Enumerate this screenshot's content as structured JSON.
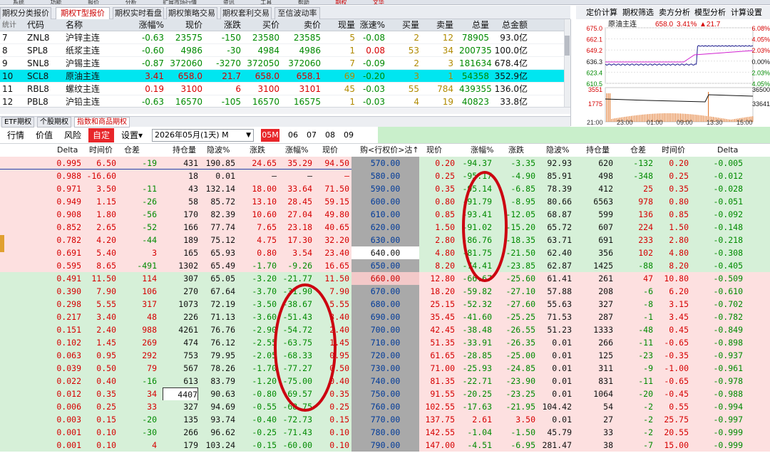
{
  "menubar": {
    "items": [
      "系统",
      "功能",
      "报价",
      "分析",
      "扩展市场行情",
      "资讯",
      "工具",
      "帮助",
      "期权",
      "文华"
    ]
  },
  "tabs": [
    "期权分类报价",
    "期权T型报价",
    "期权实时看盘",
    "期权策略交易",
    "期权套利交易",
    "至信波动率"
  ],
  "right_menu": [
    "定价计算",
    "期权筛选",
    "卖方分析",
    "模型分析",
    "计算设置"
  ],
  "futures": {
    "headers": [
      "统计",
      "代码",
      "名称",
      "涨幅%",
      "现价",
      "涨跌",
      "买价",
      "卖价",
      "现量",
      "涨速%",
      "买量",
      "卖量",
      "总量",
      "总金额"
    ],
    "rows": [
      [
        "7",
        "ZNL8",
        "沪锌主连",
        "-0.63",
        "23575",
        "-150",
        "23580",
        "23585",
        "5",
        "-0.08",
        "2",
        "12",
        "78905",
        "93.0亿"
      ],
      [
        "8",
        "SPL8",
        "纸浆主连",
        "-0.60",
        "4986",
        "-30",
        "4984",
        "4986",
        "1",
        "0.08",
        "53",
        "34",
        "200735",
        "100.0亿"
      ],
      [
        "9",
        "SNL8",
        "沪锡主连",
        "-0.87",
        "372060",
        "-3270",
        "372050",
        "372060",
        "7",
        "-0.09",
        "2",
        "3",
        "181634",
        "678.4亿"
      ],
      [
        "10",
        "SCL8",
        "原油主连",
        "3.41",
        "658.0",
        "21.7",
        "658.0",
        "658.1",
        "69",
        "-0.20",
        "3",
        "1",
        "54358",
        "352.9亿"
      ],
      [
        "11",
        "RBL8",
        "螺纹主连",
        "0.19",
        "3100",
        "6",
        "3100",
        "3101",
        "45",
        "-0.03",
        "55",
        "784",
        "439355",
        "136.0亿"
      ],
      [
        "12",
        "PBL8",
        "沪铅主连",
        "-0.63",
        "16570",
        "-105",
        "16570",
        "16575",
        "1",
        "-0.03",
        "4",
        "19",
        "40823",
        "33.8亿"
      ]
    ]
  },
  "mini_chart": {
    "title": "原油主连",
    "price": "658.0",
    "pct": "3.41%",
    "chg": "▲21.7",
    "y_left": [
      "675.0",
      "662.1",
      "649.2",
      "636.3",
      "623.4",
      "610.5"
    ],
    "y_right": [
      "6.08%",
      "4.05%",
      "2.03%",
      "0.00%",
      "2.03%",
      "4.05%"
    ],
    "vol_left": [
      "3551",
      "1775"
    ],
    "vol_right": [
      "36500",
      "33641"
    ],
    "x_ticks": [
      "21:00",
      "23:00",
      "01:00",
      "09:00",
      "13:30",
      "15:00"
    ]
  },
  "bottom_tabs": [
    "ETF期权",
    "个股期权",
    "指数和商品期权"
  ],
  "toolbar": {
    "items": [
      "行情",
      "价值",
      "风险",
      "自定",
      "设置▾"
    ],
    "contract": "2026年05月(1天)  M",
    "months": [
      "05M",
      "06",
      "07",
      "08",
      "09"
    ]
  },
  "option_headers": {
    "call": [
      "Delta",
      "时间价",
      "仓差",
      "持仓量",
      "隐波%",
      "涨跌",
      "涨幅%",
      "现价"
    ],
    "mid": "购<行权价>沽↑",
    "put": [
      "现价",
      "涨幅%",
      "涨跌",
      "隐波%",
      "持仓量",
      "仓差",
      "时间价",
      "Delta"
    ]
  },
  "options": [
    {
      "c": [
        "0.995",
        "6.50",
        "-19",
        "431",
        "190.85",
        "24.65",
        "35.29",
        "94.50"
      ],
      "k": "570.00",
      "p": [
        "0.20",
        "-94.37",
        "-3.35",
        "92.93",
        "620",
        "-132",
        "0.20",
        "-0.005"
      ]
    },
    {
      "c": [
        "0.988",
        "-16.60",
        "",
        "18",
        "0.01",
        "–",
        "–",
        "–"
      ],
      "k": "580.00",
      "p": [
        "0.25",
        "-95.17",
        "-4.90",
        "85.91",
        "498",
        "-348",
        "0.25",
        "-0.012"
      ]
    },
    {
      "c": [
        "0.971",
        "3.50",
        "-11",
        "43",
        "132.14",
        "18.00",
        "33.64",
        "71.50"
      ],
      "k": "590.00",
      "p": [
        "0.35",
        "-95.14",
        "-6.85",
        "78.39",
        "412",
        "25",
        "0.35",
        "-0.028"
      ]
    },
    {
      "c": [
        "0.949",
        "1.15",
        "-26",
        "58",
        "85.72",
        "13.10",
        "28.45",
        "59.15"
      ],
      "k": "600.00",
      "p": [
        "0.80",
        "-91.79",
        "-8.95",
        "80.66",
        "6563",
        "978",
        "0.80",
        "-0.051"
      ]
    },
    {
      "c": [
        "0.908",
        "1.80",
        "-56",
        "170",
        "82.39",
        "10.60",
        "27.04",
        "49.80"
      ],
      "k": "610.00",
      "p": [
        "0.85",
        "-93.41",
        "-12.05",
        "68.87",
        "599",
        "136",
        "0.85",
        "-0.092"
      ]
    },
    {
      "c": [
        "0.852",
        "2.65",
        "-52",
        "166",
        "77.74",
        "7.65",
        "23.18",
        "40.65"
      ],
      "k": "620.00",
      "p": [
        "1.50",
        "-91.02",
        "-15.20",
        "65.72",
        "607",
        "224",
        "1.50",
        "-0.148"
      ]
    },
    {
      "c": [
        "0.782",
        "4.20",
        "-44",
        "189",
        "75.12",
        "4.75",
        "17.30",
        "32.20"
      ],
      "k": "630.00",
      "p": [
        "2.80",
        "-86.76",
        "-18.35",
        "63.71",
        "691",
        "233",
        "2.80",
        "-0.218"
      ]
    },
    {
      "c": [
        "0.691",
        "5.40",
        "3",
        "165",
        "65.93",
        "0.80",
        "3.54",
        "23.40"
      ],
      "k": "640.00",
      "p": [
        "4.80",
        "-81.75",
        "-21.50",
        "62.40",
        "356",
        "102",
        "4.80",
        "-0.308"
      ]
    },
    {
      "c": [
        "0.595",
        "8.65",
        "-491",
        "1302",
        "65.49",
        "-1.70",
        "-9.26",
        "16.65"
      ],
      "k": "650.00",
      "p": [
        "8.20",
        "-74.41",
        "-23.85",
        "62.87",
        "1425",
        "-88",
        "8.20",
        "-0.405"
      ]
    },
    {
      "c": [
        "0.491",
        "11.50",
        "114",
        "307",
        "65.05",
        "-3.20",
        "-21.77",
        "11.50"
      ],
      "k": "660.00",
      "p": [
        "12.80",
        "-66.67",
        "-25.60",
        "61.41",
        "261",
        "47",
        "10.80",
        "-0.509"
      ]
    },
    {
      "c": [
        "0.390",
        "7.90",
        "106",
        "270",
        "67.64",
        "-3.70",
        "-31.90",
        "7.90"
      ],
      "k": "670.00",
      "p": [
        "18.20",
        "-59.82",
        "-27.10",
        "57.88",
        "208",
        "-6",
        "6.20",
        "-0.610"
      ]
    },
    {
      "c": [
        "0.298",
        "5.55",
        "317",
        "1073",
        "72.19",
        "-3.50",
        "-38.67",
        "5.55"
      ],
      "k": "680.00",
      "p": [
        "25.15",
        "-52.32",
        "-27.60",
        "55.63",
        "327",
        "-8",
        "3.15",
        "-0.702"
      ]
    },
    {
      "c": [
        "0.217",
        "3.40",
        "48",
        "226",
        "71.13",
        "-3.60",
        "-51.43",
        "3.40"
      ],
      "k": "690.00",
      "p": [
        "35.45",
        "-41.60",
        "-25.25",
        "71.53",
        "287",
        "-1",
        "3.45",
        "-0.782"
      ]
    },
    {
      "c": [
        "0.151",
        "2.40",
        "988",
        "4261",
        "76.76",
        "-2.90",
        "-54.72",
        "2.40"
      ],
      "k": "700.00",
      "p": [
        "42.45",
        "-38.48",
        "-26.55",
        "51.23",
        "1333",
        "-48",
        "0.45",
        "-0.849"
      ]
    },
    {
      "c": [
        "0.102",
        "1.45",
        "269",
        "474",
        "76.12",
        "-2.55",
        "-63.75",
        "1.45"
      ],
      "k": "710.00",
      "p": [
        "51.35",
        "-33.91",
        "-26.35",
        "0.01",
        "266",
        "-11",
        "-0.65",
        "-0.898"
      ]
    },
    {
      "c": [
        "0.063",
        "0.95",
        "292",
        "753",
        "79.95",
        "-2.05",
        "-68.33",
        "0.95"
      ],
      "k": "720.00",
      "p": [
        "61.65",
        "-28.85",
        "-25.00",
        "0.01",
        "125",
        "-23",
        "-0.35",
        "-0.937"
      ]
    },
    {
      "c": [
        "0.039",
        "0.50",
        "79",
        "567",
        "78.26",
        "-1.70",
        "-77.27",
        "0.50"
      ],
      "k": "730.00",
      "p": [
        "71.00",
        "-25.93",
        "-24.85",
        "0.01",
        "311",
        "-9",
        "-1.00",
        "-0.961"
      ]
    },
    {
      "c": [
        "0.022",
        "0.40",
        "-16",
        "613",
        "83.79",
        "-1.20",
        "-75.00",
        "0.40"
      ],
      "k": "740.00",
      "p": [
        "81.35",
        "-22.71",
        "-23.90",
        "0.01",
        "831",
        "-11",
        "-0.65",
        "-0.978"
      ]
    },
    {
      "c": [
        "0.012",
        "0.35",
        "34",
        "4407",
        "90.63",
        "-0.80",
        "-69.57",
        "0.35"
      ],
      "k": "750.00",
      "p": [
        "91.55",
        "-20.25",
        "-23.25",
        "0.01",
        "1064",
        "-20",
        "-0.45",
        "-0.988"
      ]
    },
    {
      "c": [
        "0.006",
        "0.25",
        "33",
        "327",
        "94.69",
        "-0.55",
        "-68.75",
        "0.25"
      ],
      "k": "760.00",
      "p": [
        "102.55",
        "-17.63",
        "-21.95",
        "104.42",
        "54",
        "-2",
        "0.55",
        "-0.994"
      ]
    },
    {
      "c": [
        "0.003",
        "0.15",
        "-20",
        "135",
        "93.74",
        "-0.40",
        "-72.73",
        "0.15"
      ],
      "k": "770.00",
      "p": [
        "137.75",
        "2.61",
        "3.50",
        "0.01",
        "27",
        "-2",
        "25.75",
        "-0.997"
      ]
    },
    {
      "c": [
        "0.001",
        "0.10",
        "-30",
        "266",
        "96.62",
        "-0.25",
        "-71.43",
        "0.10"
      ],
      "k": "780.00",
      "p": [
        "142.55",
        "-1.04",
        "-1.50",
        "45.79",
        "33",
        "-2",
        "20.55",
        "-0.999"
      ]
    },
    {
      "c": [
        "0.001",
        "0.10",
        "4",
        "179",
        "103.24",
        "-0.15",
        "-60.00",
        "0.10"
      ],
      "k": "790.00",
      "p": [
        "147.00",
        "-4.51",
        "-6.95",
        "281.47",
        "38",
        "-7",
        "15.00",
        "-0.999"
      ]
    }
  ],
  "colors": {
    "accent_red": "#e8262a",
    "up": "#d60000",
    "down": "#008a00",
    "call_itm_bg": "#fde0e0",
    "put_otm_bg": "#d8f0da",
    "atm_bg": "#fff"
  }
}
